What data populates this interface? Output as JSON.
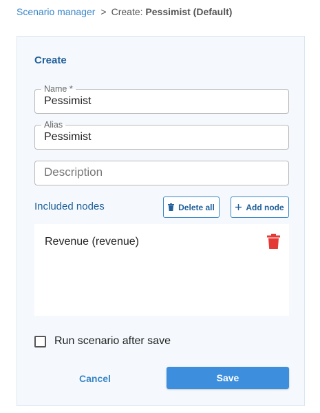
{
  "breadcrumb": {
    "parent": "Scenario manager",
    "separator": ">",
    "current_prefix": "Create: ",
    "current_name": "Pessimist (Default)"
  },
  "form": {
    "title": "Create",
    "name": {
      "label": "Name *",
      "value": "Pessimist"
    },
    "alias": {
      "label": "Alias",
      "value": "Pessimist"
    },
    "description": {
      "placeholder": "Description",
      "value": ""
    }
  },
  "nodes": {
    "header": "Included nodes",
    "delete_all_label": "Delete all",
    "add_node_label": "Add node",
    "items": [
      {
        "label": "Revenue (revenue)"
      }
    ]
  },
  "options": {
    "run_after_save_label": "Run scenario after save",
    "run_after_save_checked": false
  },
  "actions": {
    "cancel_label": "Cancel",
    "save_label": "Save"
  },
  "colors": {
    "accent": "#3d8fde",
    "link": "#3a86c8",
    "heading": "#1f5f9a",
    "delete": "#e53935",
    "panel_bg": "#f5f9fd"
  }
}
